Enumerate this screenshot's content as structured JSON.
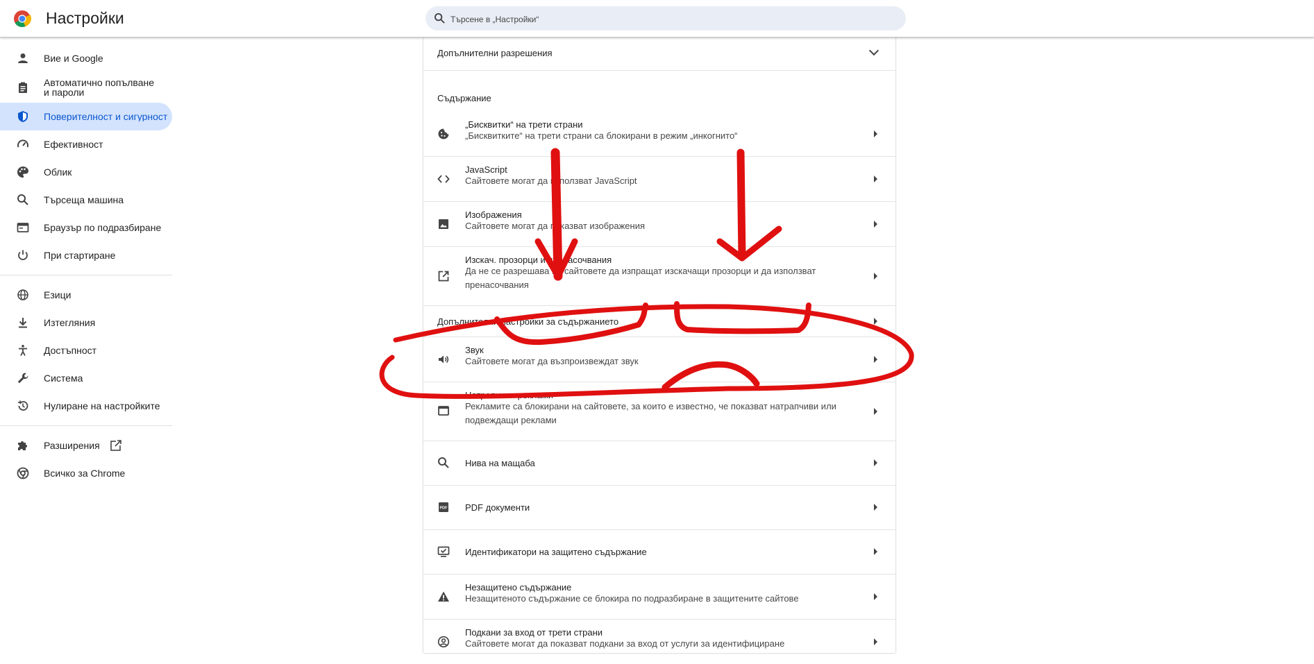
{
  "header": {
    "title": "Настройки",
    "search_placeholder": "Търсене в „Настройки“"
  },
  "sidebar": {
    "items": [
      {
        "label": "Вие и Google",
        "icon": "person-icon"
      },
      {
        "label": "Автоматично попълване и пароли",
        "icon": "clipboard-icon"
      },
      {
        "label": "Поверителност и сигурност",
        "icon": "shield-icon",
        "active": true
      },
      {
        "label": "Ефективност",
        "icon": "speedometer-icon"
      },
      {
        "label": "Облик",
        "icon": "palette-icon"
      },
      {
        "label": "Търсеща машина",
        "icon": "search-icon"
      },
      {
        "label": "Браузър по подразбиране",
        "icon": "browser-icon"
      },
      {
        "label": "При стартиране",
        "icon": "power-icon"
      },
      {
        "label": "Езици",
        "icon": "globe-icon"
      },
      {
        "label": "Изтегляния",
        "icon": "download-icon"
      },
      {
        "label": "Достъпност",
        "icon": "accessibility-icon"
      },
      {
        "label": "Система",
        "icon": "wrench-icon"
      },
      {
        "label": "Нулиране на настройките",
        "icon": "reset-history-icon"
      },
      {
        "label": "Разширения",
        "icon": "puzzle-icon"
      },
      {
        "label": "Всичко за Chrome",
        "icon": "chrome-icon"
      }
    ]
  },
  "main": {
    "additional_permissions": "Допълнителни разрешения",
    "content_section_title": "Съдържание",
    "rows": [
      {
        "title": "„Бисквитки“ на трети страни",
        "subtitle": "„Бисквитките“ на трети страни са блокирани в режим „инкогнито“",
        "icon": "cookie-icon"
      },
      {
        "title": "JavaScript",
        "subtitle": "Сайтовете могат да използват JavaScript",
        "icon": "code-icon"
      },
      {
        "title": "Изображения",
        "subtitle": "Сайтовете могат да показват изображения",
        "icon": "image-icon"
      },
      {
        "title": "Изскач. прозорци и пренасочвания",
        "subtitle": "Да не се разрешава на сайтовете да изпращат изскачащи прозорци и да използват пренасочвания",
        "icon": "external-link-icon"
      }
    ],
    "additional_content_settings": "Допълнителни настройки за съдържанието",
    "rows2": [
      {
        "title": "Звук",
        "subtitle": "Сайтовете могат да възпроизвеждат звук",
        "icon": "speaker-icon"
      },
      {
        "title": "Натрапчиви реклами",
        "subtitle": "Рекламите са блокирани на сайтовете, за които е известно, че показват натрапчиви или подвеждащи реклами",
        "icon": "ads-window-icon"
      },
      {
        "title": "Нива на мащаба",
        "subtitle": "",
        "icon": "zoom-icon"
      },
      {
        "title": "PDF документи",
        "subtitle": "",
        "icon": "pdf-icon"
      },
      {
        "title": "Идентификатори на защитено съдържание",
        "subtitle": "",
        "icon": "protected-content-icon"
      },
      {
        "title": "Незащитено съдържание",
        "subtitle": "Незащитеното съдържание се блокира по подразбиране в защитените сайтове",
        "icon": "warning-icon"
      },
      {
        "title": "Подкани за вход от трети страни",
        "subtitle": "Сайтовете могат да показват подкани за вход от услуги за идентифициране",
        "icon": "account-circle-icon"
      }
    ]
  },
  "colors": {
    "accent": "#0b57d0",
    "active_bg": "#d3e3fd",
    "annotation_red": "#e01010"
  }
}
